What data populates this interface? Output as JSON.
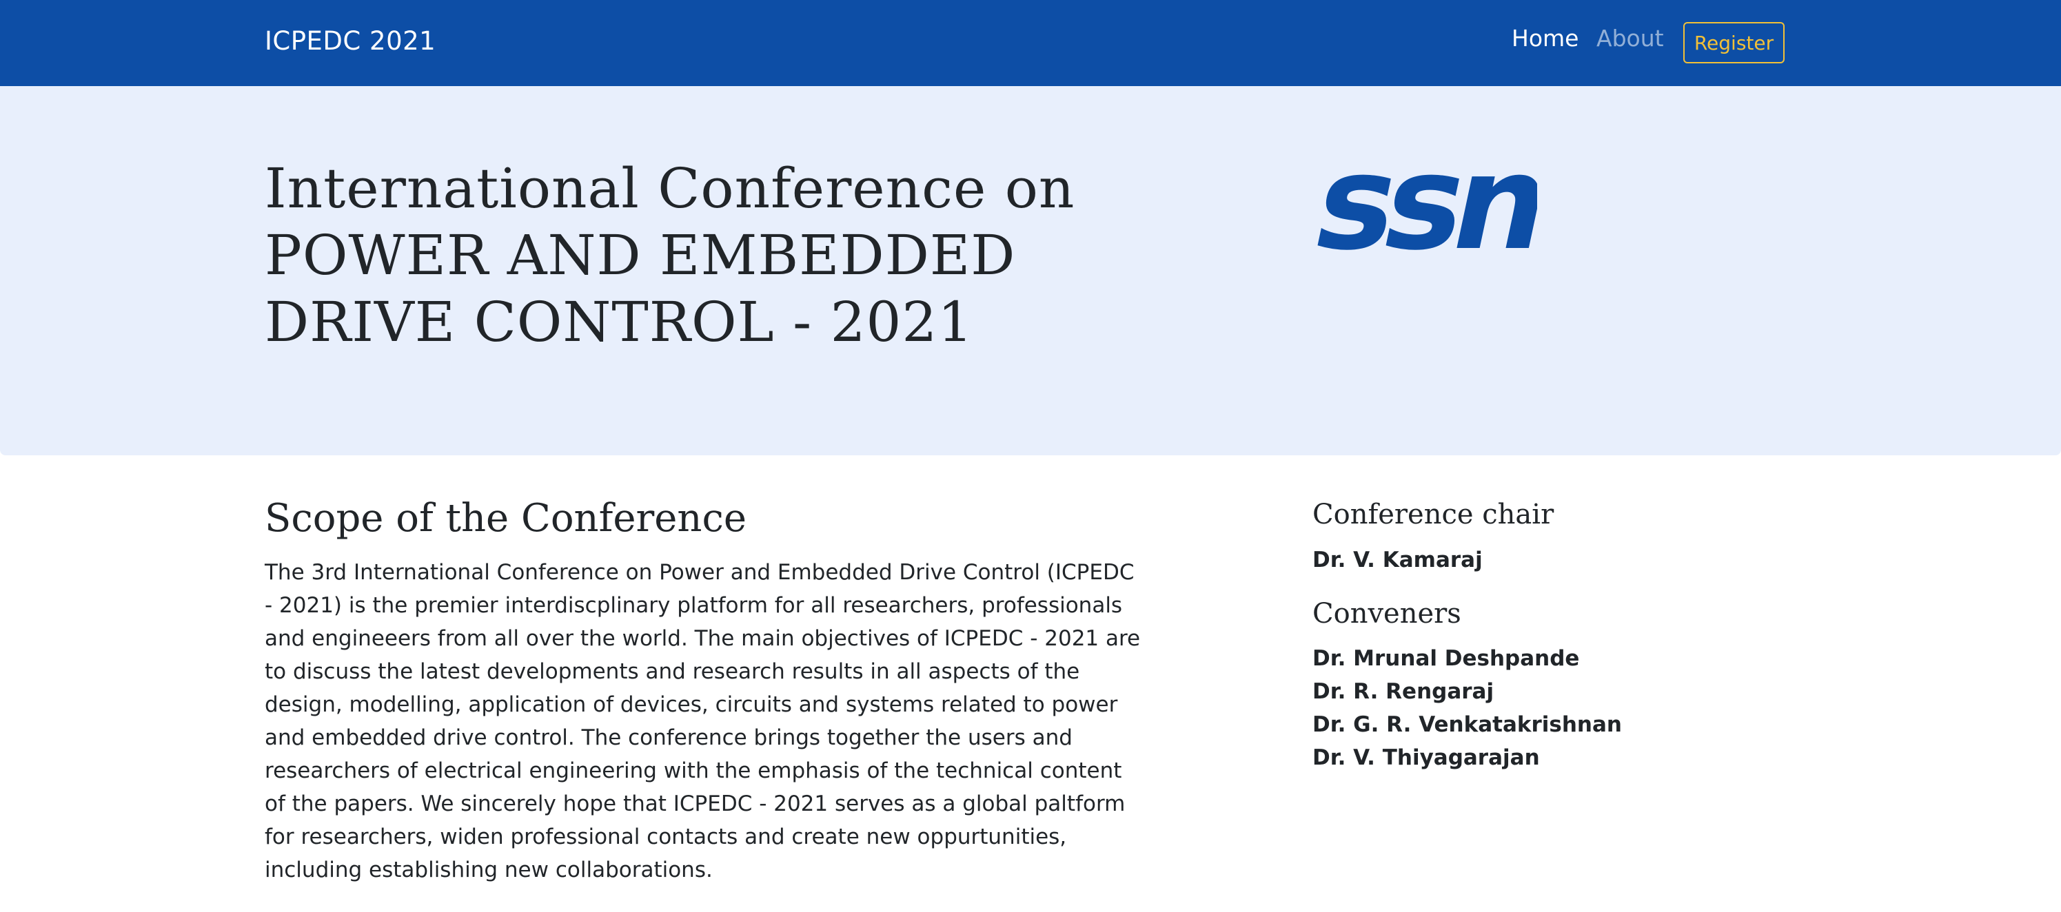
{
  "navbar": {
    "brand": "ICPEDC 2021",
    "links": [
      {
        "label": "Home",
        "active": true
      },
      {
        "label": "About",
        "active": false
      }
    ],
    "register_label": "Register",
    "background": "#0d4ea6",
    "register_color": "#f2c037"
  },
  "hero": {
    "title_lines": [
      "International Conference on",
      "POWER AND EMBEDDED",
      "DRIVE CONTROL - 2021"
    ],
    "logo_text": "ssn",
    "background": "#e8effc"
  },
  "scope": {
    "heading": "Scope of the Conference",
    "text": "The 3rd International Conference on Power and Embedded Drive Control (ICPEDC - 2021) is the premier interdiscplinary platform for all researchers, professionals and engineeers from all over the world. The main objectives of ICPEDC - 2021 are to discuss the latest developments and research results in all aspects of the design, modelling, application of devices, circuits and systems related to power and embedded drive control. The conference brings together the users and researchers of electrical engineering with the emphasis of the technical content of the papers. We sincerely hope that ICPEDC - 2021 serves as a global paltform for researchers, widen professional contacts and create new oppurtunities, including establishing new collaborations."
  },
  "sidebar": {
    "chair_heading": "Conference chair",
    "chair": [
      "Dr. V. Kamaraj"
    ],
    "conveners_heading": "Conveners",
    "conveners": [
      "Dr. Mrunal Deshpande",
      "Dr. R. Rengaraj",
      "Dr. G. R. Venkatakrishnan",
      "Dr. V. Thiyagarajan"
    ]
  }
}
